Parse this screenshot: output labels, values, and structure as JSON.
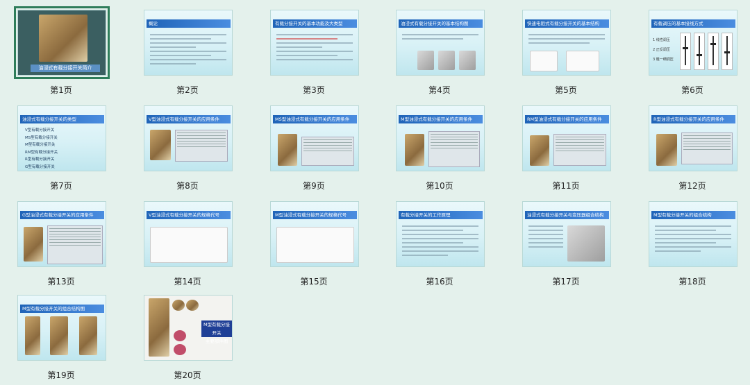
{
  "slides": [
    {
      "label": "第1页",
      "title": "油浸式有载分接开关简介",
      "selected": true
    },
    {
      "label": "第2页",
      "title": "概论"
    },
    {
      "label": "第3页",
      "title": "有载分接开关的基本功能及大类型"
    },
    {
      "label": "第4页",
      "title": "油浸式有载分接开关的基本结构图"
    },
    {
      "label": "第5页",
      "title": "快速电阻式有载分接开关的基本结构"
    },
    {
      "label": "第6页",
      "title": "有载调压的基本接线方式"
    },
    {
      "label": "第7页",
      "title": "油浸式有载分接开关的类型"
    },
    {
      "label": "第8页",
      "title": "V型油浸式有载分接开关的应用条件"
    },
    {
      "label": "第9页",
      "title": "MS型油浸式有载分接开关的应用条件"
    },
    {
      "label": "第10页",
      "title": "M型油浸式有载分接开关的应用条件"
    },
    {
      "label": "第11页",
      "title": "RM型油浸式有载分接开关的应用条件"
    },
    {
      "label": "第12页",
      "title": "R型油浸式有载分接开关的应用条件"
    },
    {
      "label": "第13页",
      "title": "G型油浸式有载分接开关的应用条件"
    },
    {
      "label": "第14页",
      "title": "V型油浸式有载分接开关的规格代号"
    },
    {
      "label": "第15页",
      "title": "M型油浸式有载分接开关的规格代号"
    },
    {
      "label": "第16页",
      "title": "有载分接开关的工作原理"
    },
    {
      "label": "第17页",
      "title": "油浸式有载分接开关与变压器组合结构"
    },
    {
      "label": "第18页",
      "title": "M型有载分接开关的组合结构"
    },
    {
      "label": "第19页",
      "title": "M型有载分接开关的组合结构图"
    },
    {
      "label": "第20页",
      "title": "M型有载分接开关主要部件图"
    }
  ],
  "slide6_items": [
    "1 线性调压",
    "2 正反调压",
    "3 粗一细调压"
  ],
  "slide7_items": [
    "V型有载分接开关",
    "MS型有载分接开关",
    "M型有载分接开关",
    "RM型有载分接开关",
    "R型有载分接开关",
    "G型有载分接开关"
  ],
  "slide20_box": [
    "M型有载分接开关",
    "主要部件图"
  ]
}
